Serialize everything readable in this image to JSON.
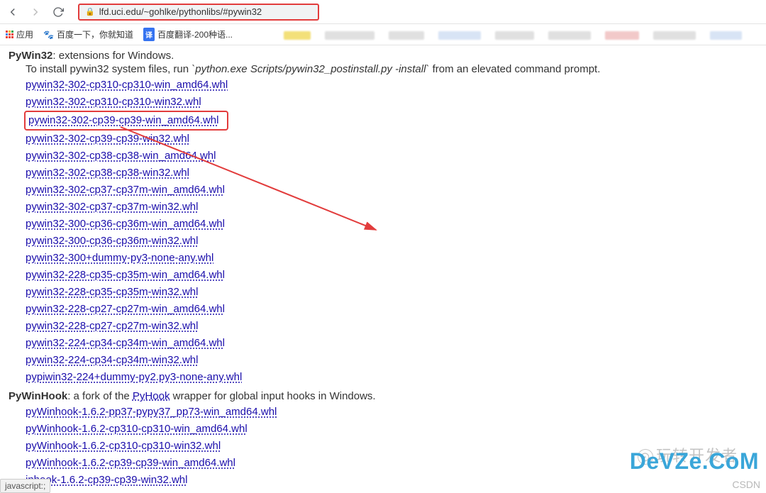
{
  "toolbar": {
    "url": "lfd.uci.edu/~gohlke/pythonlibs/#pywin32"
  },
  "bookmarks": {
    "apps": "应用",
    "baidu": "百度一下，你就知道",
    "trans": "百度翻译-200种语..."
  },
  "pywin32": {
    "title": "PyWin32",
    "desc": ": extensions for Windows.",
    "install_prefix": "To install pywin32 system files, run ",
    "install_cmd": "`python.exe Scripts/pywin32_postinstall.py -install`",
    "install_suffix": " from an elevated command prompt.",
    "links": [
      "pywin32-302-cp310-cp310-win_amd64.whl",
      "pywin32-302-cp310-cp310-win32.whl",
      "pywin32-302-cp39-cp39-win_amd64.whl",
      "pywin32-302-cp39-cp39-win32.whl",
      "pywin32-302-cp38-cp38-win_amd64.whl",
      "pywin32-302-cp38-cp38-win32.whl",
      "pywin32-302-cp37-cp37m-win_amd64.whl",
      "pywin32-302-cp37-cp37m-win32.whl",
      "pywin32-300-cp36-cp36m-win_amd64.whl",
      "pywin32-300-cp36-cp36m-win32.whl",
      "pywin32-300+dummy-py3-none-any.whl",
      "pywin32-228-cp35-cp35m-win_amd64.whl",
      "pywin32-228-cp35-cp35m-win32.whl",
      "pywin32-228-cp27-cp27m-win_amd64.whl",
      "pywin32-228-cp27-cp27m-win32.whl",
      "pywin32-224-cp34-cp34m-win_amd64.whl",
      "pywin32-224-cp34-cp34m-win32.whl",
      "pypiwin32-224+dummy-py2.py3-none-any.whl"
    ],
    "highlight_index": 2
  },
  "pywinhook": {
    "title": "PyWinHook",
    "desc_prefix": ": a fork of the ",
    "pyhook": "PyHook",
    "desc_suffix": " wrapper for global input hooks in Windows.",
    "links": [
      "pyWinhook-1.6.2-pp37-pypy37_pp73-win_amd64.whl",
      "pyWinhook-1.6.2-cp310-cp310-win_amd64.whl",
      "pyWinhook-1.6.2-cp310-cp310-win32.whl",
      "pyWinhook-1.6.2-cp39-cp39-win_amd64.whl",
      "inhook-1.6.2-cp39-cp39-win32.whl"
    ]
  },
  "status_bar": "javascript:;",
  "watermarks": {
    "brand": "玩转开发者",
    "devze": "DeVZe.CoM",
    "csdn": "CSDN"
  }
}
